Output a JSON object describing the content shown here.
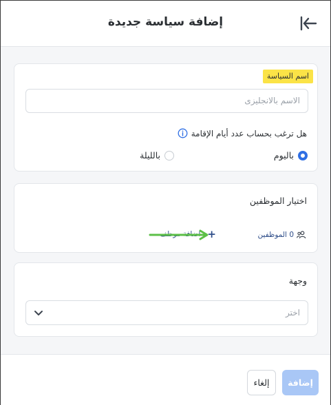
{
  "header": {
    "title": "إضافة سياسة جديدة",
    "back_icon": "collapse-arrow-icon"
  },
  "policy": {
    "name_label": "اسم السياسة",
    "name_placeholder": "الاسم بالانجليزى",
    "question": "هل ترغب بحساب عدد أيام الإقامة",
    "options": [
      {
        "label": "باليوم",
        "selected": true
      },
      {
        "label": "بالليلة",
        "selected": false
      }
    ]
  },
  "employees": {
    "title": "اختيار الموظفين",
    "count_text": "0 الموظفين",
    "add_label": "اضافة موظف"
  },
  "destination": {
    "title": "وجهة",
    "placeholder": "اختر"
  },
  "footer": {
    "add_label": "إضافة",
    "cancel_label": "إلغاء"
  },
  "colors": {
    "accent": "#2f6fe4",
    "highlight": "#fbe347",
    "arrow": "#5cbf47",
    "disabled_button": "#a9c7f6"
  }
}
